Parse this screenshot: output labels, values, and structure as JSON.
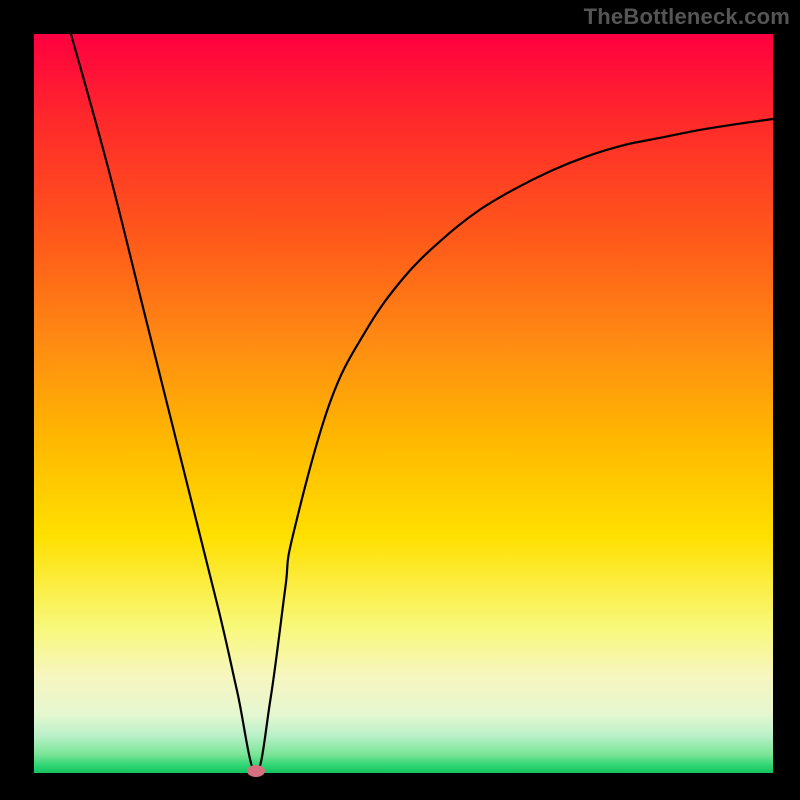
{
  "watermark": "TheBottleneck.com",
  "chart_data": {
    "type": "line",
    "title": "",
    "xlabel": "",
    "ylabel": "",
    "xlim": [
      0,
      100
    ],
    "ylim": [
      0,
      100
    ],
    "grid": false,
    "legend": false,
    "background_gradient": {
      "top_color": "#ff0040",
      "bottom_color": "#14c25e",
      "meaning": "red (high bottleneck) to green (low bottleneck)"
    },
    "series": [
      {
        "name": "bottleneck-curve",
        "x": [
          5,
          10,
          15,
          20,
          25,
          27.5,
          30,
          32,
          34,
          35,
          40,
          45,
          50,
          55,
          60,
          65,
          70,
          75,
          80,
          85,
          90,
          95,
          100
        ],
        "y": [
          100,
          82,
          62,
          42,
          22,
          11,
          0,
          10,
          25,
          32,
          50,
          60,
          67,
          72,
          76,
          79,
          81.5,
          83.5,
          85,
          86,
          87,
          87.8,
          88.5
        ]
      }
    ],
    "marker": {
      "name": "bottleneck-minimum",
      "x": 30,
      "y": 0,
      "color": "#d47080"
    }
  }
}
